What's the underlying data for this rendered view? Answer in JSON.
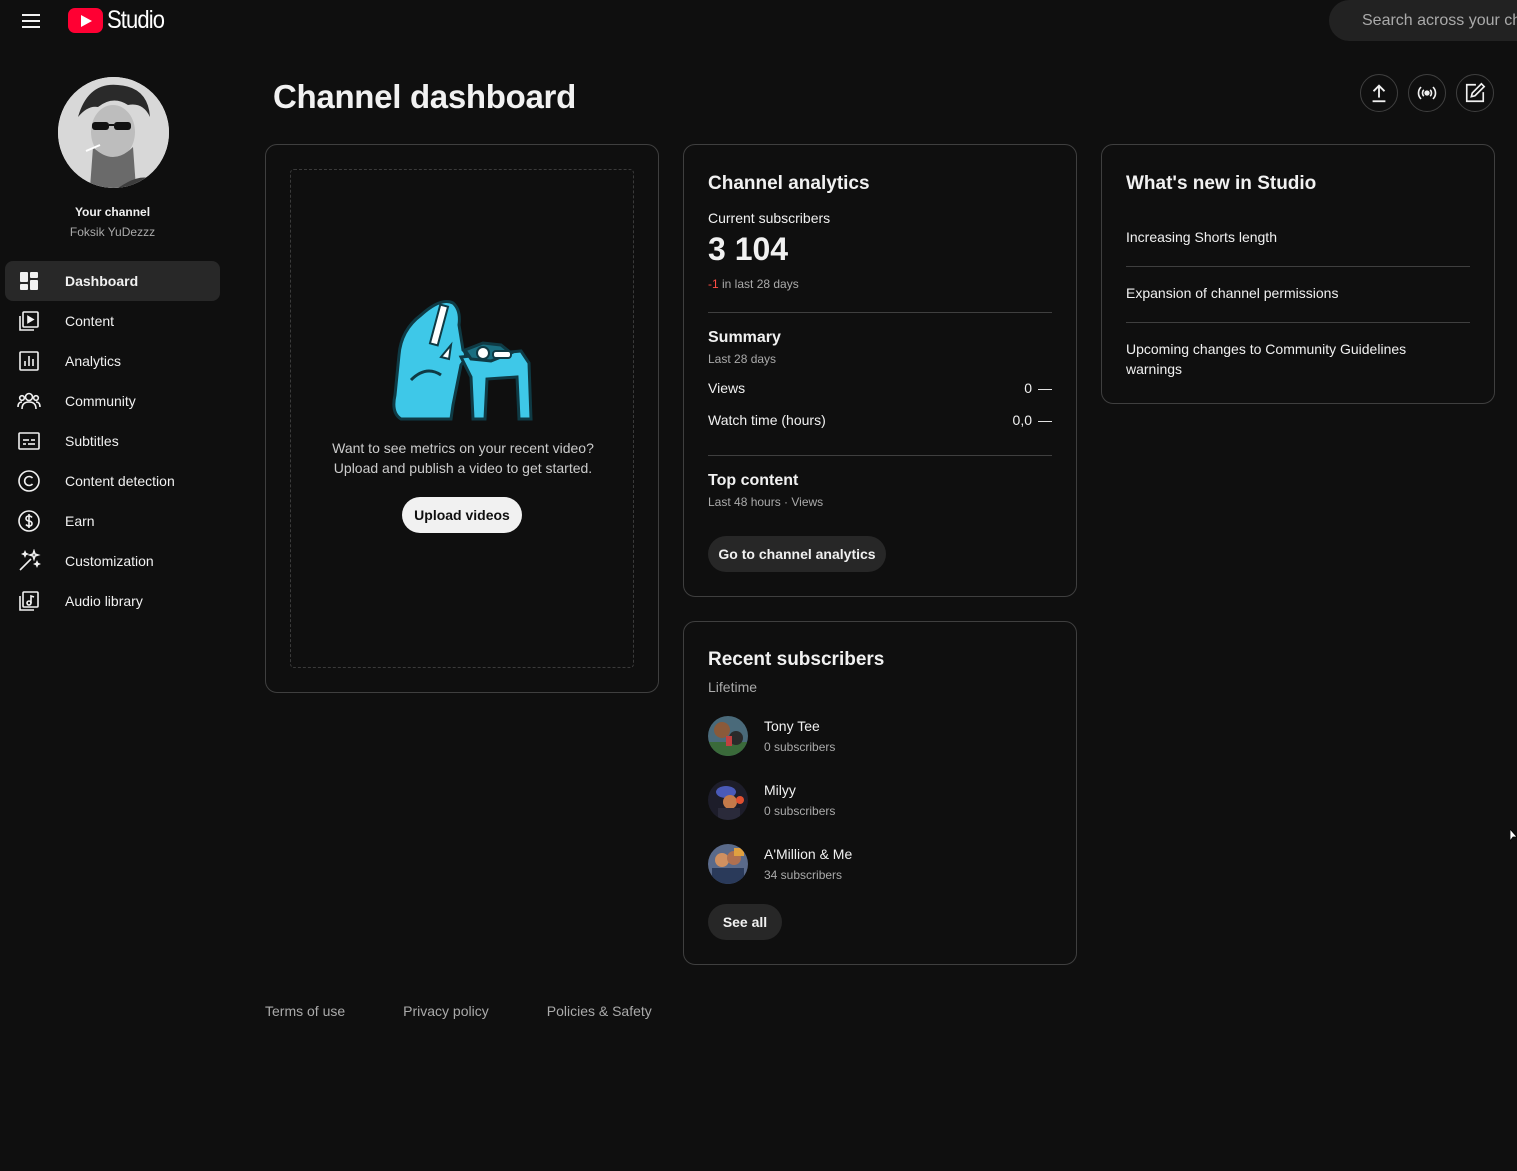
{
  "header": {
    "logo_text": "Studio",
    "search_placeholder": "Search across your channel",
    "brand_color": "#ff0033"
  },
  "sidebar": {
    "your_channel_label": "Your channel",
    "channel_name": "Foksik YuDezzz",
    "items": [
      {
        "label": "Dashboard",
        "icon": "dashboard-icon",
        "active": true
      },
      {
        "label": "Content",
        "icon": "content-icon"
      },
      {
        "label": "Analytics",
        "icon": "analytics-icon"
      },
      {
        "label": "Community",
        "icon": "community-icon"
      },
      {
        "label": "Subtitles",
        "icon": "subtitles-icon"
      },
      {
        "label": "Content detection",
        "icon": "copyright-icon"
      },
      {
        "label": "Earn",
        "icon": "dollar-icon"
      },
      {
        "label": "Customization",
        "icon": "magic-wand-icon"
      },
      {
        "label": "Audio library",
        "icon": "audio-library-icon"
      }
    ]
  },
  "main": {
    "title": "Channel dashboard",
    "actions": [
      "upload-icon",
      "live-icon",
      "create-post-icon"
    ]
  },
  "upload_card": {
    "message_line1": "Want to see metrics on your recent video?",
    "message_line2": "Upload and publish a video to get started.",
    "button_label": "Upload videos"
  },
  "analytics_card": {
    "title": "Channel analytics",
    "current_subscribers_label": "Current subscribers",
    "current_subscribers": "3 104",
    "delta_value": "-1",
    "delta_text": " in last 28 days",
    "summary_title": "Summary",
    "summary_period": "Last 28 days",
    "metrics": [
      {
        "label": "Views",
        "value": "0",
        "trend": "—"
      },
      {
        "label": "Watch time (hours)",
        "value": "0,0",
        "trend": "—"
      }
    ],
    "top_content_title": "Top content",
    "top_content_sub": "Last 48 hours · Views",
    "button_label": "Go to channel analytics"
  },
  "news_card": {
    "title": "What's new in Studio",
    "items": [
      "Increasing Shorts length",
      "Expansion of channel permissions",
      "Upcoming changes to Community Guidelines warnings"
    ]
  },
  "subs_card": {
    "title": "Recent subscribers",
    "subtitle": "Lifetime",
    "subscribers": [
      {
        "name": "Tony Tee",
        "count": "0 subscribers"
      },
      {
        "name": "Milyy",
        "count": "0 subscribers"
      },
      {
        "name": "A'Million & Me",
        "count": "34 subscribers"
      }
    ],
    "button_label": "See all"
  },
  "footer": {
    "links": [
      "Terms of use",
      "Privacy policy",
      "Policies & Safety"
    ]
  }
}
